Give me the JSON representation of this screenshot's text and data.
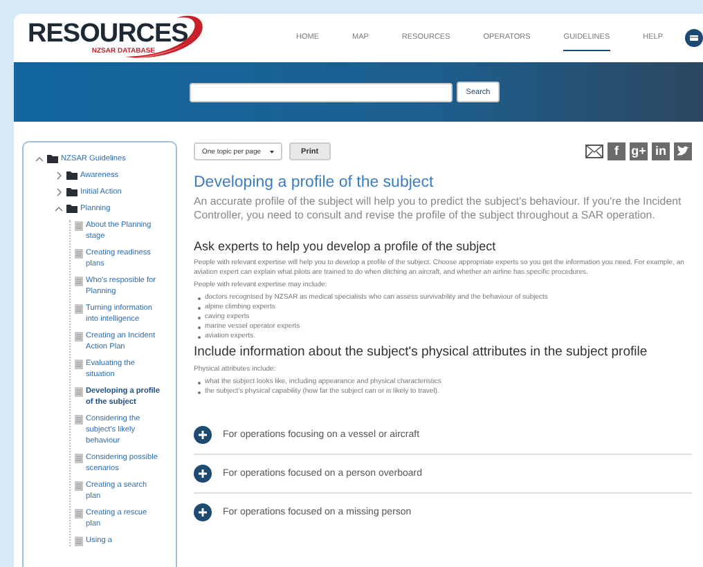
{
  "header": {
    "logo_title": "RESOURCES",
    "logo_subtitle": "NZSAR DATABASE",
    "nav": [
      {
        "label": "HOME",
        "selected": false
      },
      {
        "label": "MAP",
        "selected": false
      },
      {
        "label": "RESOURCES",
        "selected": false
      },
      {
        "label": "OPERATORS",
        "selected": false
      },
      {
        "label": "GUIDELINES",
        "selected": true
      },
      {
        "label": "HELP",
        "selected": false
      }
    ]
  },
  "search": {
    "button": "Search"
  },
  "tree": [
    {
      "label": "NZSAR Guidelines",
      "kind": "folder",
      "expanded": true,
      "children": [
        {
          "label": "Awareness",
          "kind": "folder",
          "expanded": false
        },
        {
          "label": "Initial Action",
          "kind": "folder",
          "expanded": false
        },
        {
          "label": "Planning",
          "kind": "folder",
          "expanded": true,
          "children": [
            {
              "label": "About the Planning stage",
              "kind": "page",
              "selected": false
            },
            {
              "label": "Creating readiness plans",
              "kind": "page",
              "selected": false
            },
            {
              "label": "Who's resposible for Planning",
              "kind": "page",
              "selected": false
            },
            {
              "label": "Turning information into intelligence",
              "kind": "page",
              "selected": false
            },
            {
              "label": "Creating an Incident Action Plan",
              "kind": "page",
              "selected": false
            },
            {
              "label": "Evaluating the situation",
              "kind": "page",
              "selected": false
            },
            {
              "label": "Developing a profile of the subject",
              "kind": "page",
              "selected": true
            },
            {
              "label": "Considering the subject's likely behaviour",
              "kind": "page",
              "selected": false
            },
            {
              "label": "Considering possible scenarios",
              "kind": "page",
              "selected": false
            },
            {
              "label": "Creating a search plan",
              "kind": "page",
              "selected": false
            },
            {
              "label": "Creating a rescue plan",
              "kind": "page",
              "selected": false
            },
            {
              "label": "Using a",
              "kind": "page",
              "selected": false
            }
          ]
        }
      ]
    }
  ],
  "toolbar": {
    "dropdown": "One topic per page",
    "print": "Print",
    "share": [
      {
        "kind": "email"
      },
      {
        "kind": "glyph",
        "glyph": "f"
      },
      {
        "kind": "glyph",
        "glyph": "g+"
      },
      {
        "kind": "glyph",
        "glyph": "in"
      },
      {
        "kind": "bird"
      }
    ]
  },
  "article": {
    "title": "Developing a profile of the subject",
    "intro": "An accurate profile of the subject will help you to predict the subject's behaviour.  If you're the Incident Controller, you need to consult and revise the profile of the subject throughout a SAR operation.",
    "sections": [
      {
        "heading": "Ask experts to help you develop a profile of the subject",
        "blocks": [
          {
            "kind": "paragraph",
            "text": "People with relevant expertise will help you to develop a profile of the subject. Choose appropriate experts so you get the information you need. For example, an aviation expert can explain what pilots are trained to do when ditching an aircraft, and whether an airline has specific procedures."
          },
          {
            "kind": "paragraph",
            "text": "People with relevant expertise may include:"
          },
          {
            "kind": "list",
            "items": [
              "doctors recognised by NZSAR as medical specialists who can assess survivability and the behaviour of subjects",
              "alpine climbing experts",
              "caving experts",
              "marine vessel operator experts",
              "aviation experts."
            ]
          }
        ]
      },
      {
        "heading": "Include information about the subject's physical attributes in the subject profile",
        "blocks": [
          {
            "kind": "paragraph",
            "text": "Physical attributes include:"
          },
          {
            "kind": "list",
            "items": [
              "what the subject looks like, including appearance and physical characteristics",
              "the subject's physical capability (how far the subject can or is likely to travel)."
            ]
          }
        ]
      }
    ]
  },
  "accordions": [
    {
      "label": "For operations focusing on a vessel or aircraft",
      "expanded": false
    },
    {
      "label": "For operations focused on a person overboard",
      "expanded": false
    },
    {
      "label": "For operations focused on a missing person",
      "expanded": false
    }
  ]
}
